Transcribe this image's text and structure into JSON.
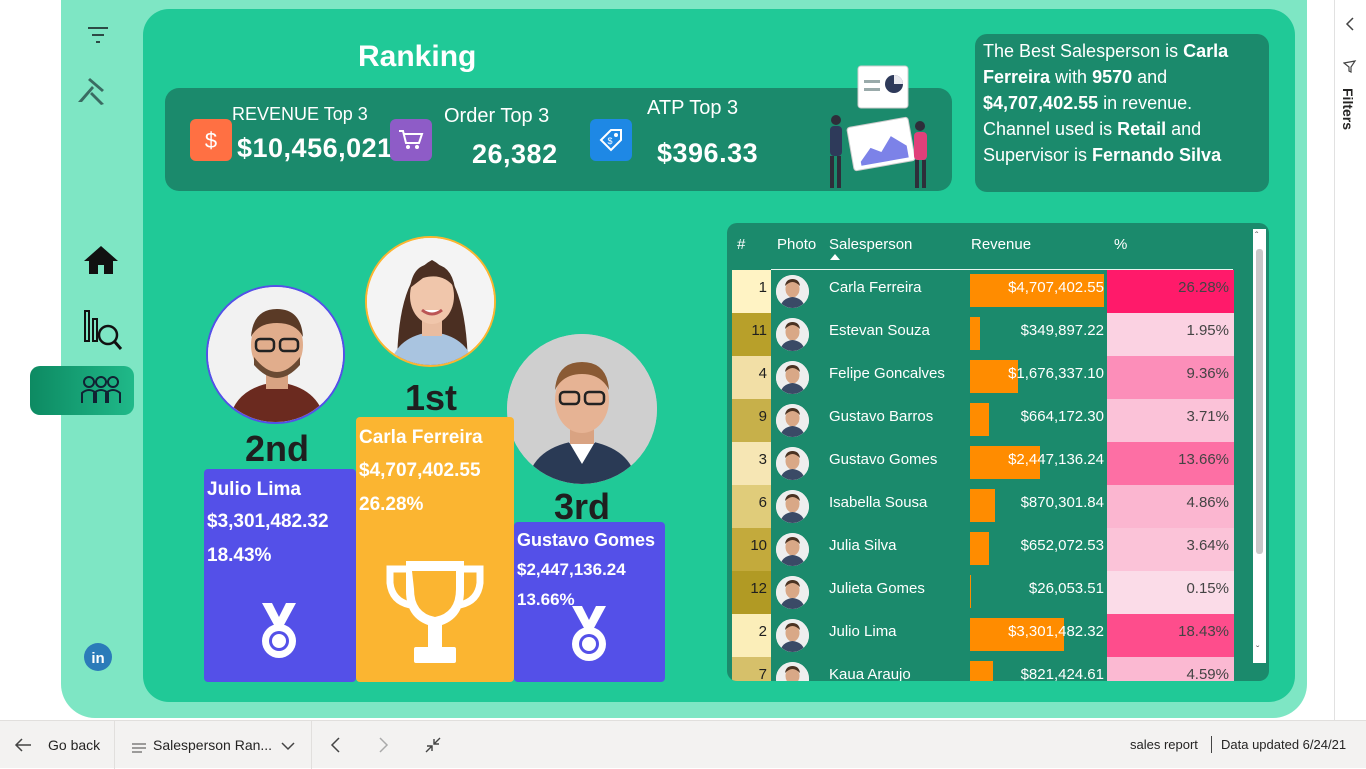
{
  "page": {
    "title": "Ranking"
  },
  "kpis": {
    "revenue": {
      "label": "REVENUE Top 3",
      "value": "$10,456,021",
      "icon": "dollar-icon",
      "color": "#ff7043"
    },
    "orders": {
      "label": "Order Top 3",
      "value": "26,382",
      "icon": "cart-icon",
      "color": "#8e5cc7"
    },
    "atp": {
      "label": "ATP Top 3",
      "value": "$396.33",
      "icon": "price-tag-icon",
      "color": "#1e88e5"
    }
  },
  "best": {
    "intro": "The Best Salesperson is ",
    "name": "Carla Ferreira",
    "with": " with ",
    "orders": "9570",
    "and": " and ",
    "revenue": "$4,707,402.55",
    "in_rev": " in revenue. Channel used is ",
    "channel": "Retail",
    "and2": " and Supervisor is ",
    "supervisor": "Fernando Silva"
  },
  "podium": {
    "first": {
      "place": "1st",
      "name": "Carla Ferreira",
      "revenue": "$4,707,402.55",
      "pct": "26.28%",
      "color": "#fbb531"
    },
    "second": {
      "place": "2nd",
      "name": "Julio Lima",
      "revenue": "$3,301,482.32",
      "pct": "18.43%",
      "color": "#5450e8"
    },
    "third": {
      "place": "3rd",
      "name": "Gustavo Gomes",
      "revenue": "$2,447,136.24",
      "pct": "13.66%",
      "color": "#5450e8"
    }
  },
  "table": {
    "headers": {
      "rank": "#",
      "photo": "Photo",
      "name": "Salesperson",
      "revenue": "Revenue",
      "pct": "%"
    },
    "rows": [
      {
        "rank": "1",
        "name": "Carla Ferreira",
        "revenue": "$4,707,402.55",
        "rev_share": 1.0,
        "pct": "26.28%",
        "rank_bg": "#fff3c4",
        "pct_bg": "#ff1a6a"
      },
      {
        "rank": "11",
        "name": "Estevan Souza",
        "revenue": "$349,897.22",
        "rev_share": 0.074,
        "pct": "1.95%",
        "rank_bg": "#b8a02a",
        "pct_bg": "#fbd2e2"
      },
      {
        "rank": "4",
        "name": "Felipe Goncalves",
        "revenue": "$1,676,337.10",
        "rev_share": 0.356,
        "pct": "9.36%",
        "rank_bg": "#f2dfa6",
        "pct_bg": "#fc8eb9"
      },
      {
        "rank": "9",
        "name": "Gustavo Barros",
        "revenue": "$664,172.30",
        "rev_share": 0.141,
        "pct": "3.71%",
        "rank_bg": "#c7b04a",
        "pct_bg": "#fbc2d8"
      },
      {
        "rank": "3",
        "name": "Gustavo Gomes",
        "revenue": "$2,447,136.24",
        "rev_share": 0.52,
        "pct": "13.66%",
        "rank_bg": "#f6e6b4",
        "pct_bg": "#fd6fa4"
      },
      {
        "rank": "6",
        "name": "Isabella Sousa",
        "revenue": "$870,301.84",
        "rev_share": 0.185,
        "pct": "4.86%",
        "rank_bg": "#e0cc7a",
        "pct_bg": "#fbb6d0"
      },
      {
        "rank": "10",
        "name": "Julia Silva",
        "revenue": "$652,072.53",
        "rev_share": 0.139,
        "pct": "3.64%",
        "rank_bg": "#c3aa3c",
        "pct_bg": "#fbc3d8"
      },
      {
        "rank": "12",
        "name": "Julieta Gomes",
        "revenue": "$26,053.51",
        "rev_share": 0.006,
        "pct": "0.15%",
        "rank_bg": "#b19a24",
        "pct_bg": "#fbdce8"
      },
      {
        "rank": "2",
        "name": "Julio Lima",
        "revenue": "$3,301,482.32",
        "rev_share": 0.701,
        "pct": "18.43%",
        "rank_bg": "#fbeeb9",
        "pct_bg": "#fe4d8c"
      },
      {
        "rank": "7",
        "name": "Kaua Araujo",
        "revenue": "$821,424.61",
        "rev_share": 0.175,
        "pct": "4.59%",
        "rank_bg": "#d6c06a",
        "pct_bg": "#fbb9d2"
      }
    ]
  },
  "filters": {
    "label": "Filters"
  },
  "bottom": {
    "go_back": "Go back",
    "page_name": "Salesperson Ran...",
    "report_name": "sales report",
    "updated": "Data updated 6/24/21"
  }
}
